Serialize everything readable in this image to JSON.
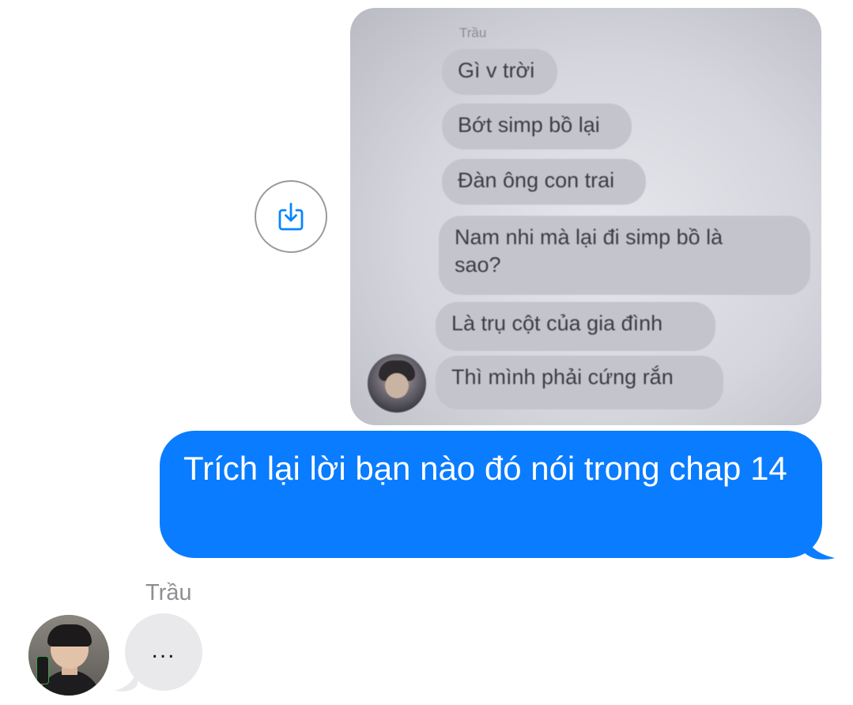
{
  "photo_attachment": {
    "sender": "Trầu",
    "messages": [
      "Gì v trời",
      "Bớt simp bồ lại",
      "Đàn ông con trai",
      "Nam nhi mà lại đi simp bồ là\nsao?",
      "Là trụ cột của gia đình",
      "Thì mình phải cứng rắn"
    ]
  },
  "save_button": {
    "icon": "download-icon"
  },
  "outgoing_message": {
    "text": "Trích lại lời bạn nào đó nói trong chap 14"
  },
  "incoming": {
    "sender": "Trầu",
    "typing": "..."
  },
  "colors": {
    "outgoing_bubble": "#0a7cff",
    "incoming_bubble": "#e9e9eb",
    "accent_icon": "#0a84ff"
  }
}
